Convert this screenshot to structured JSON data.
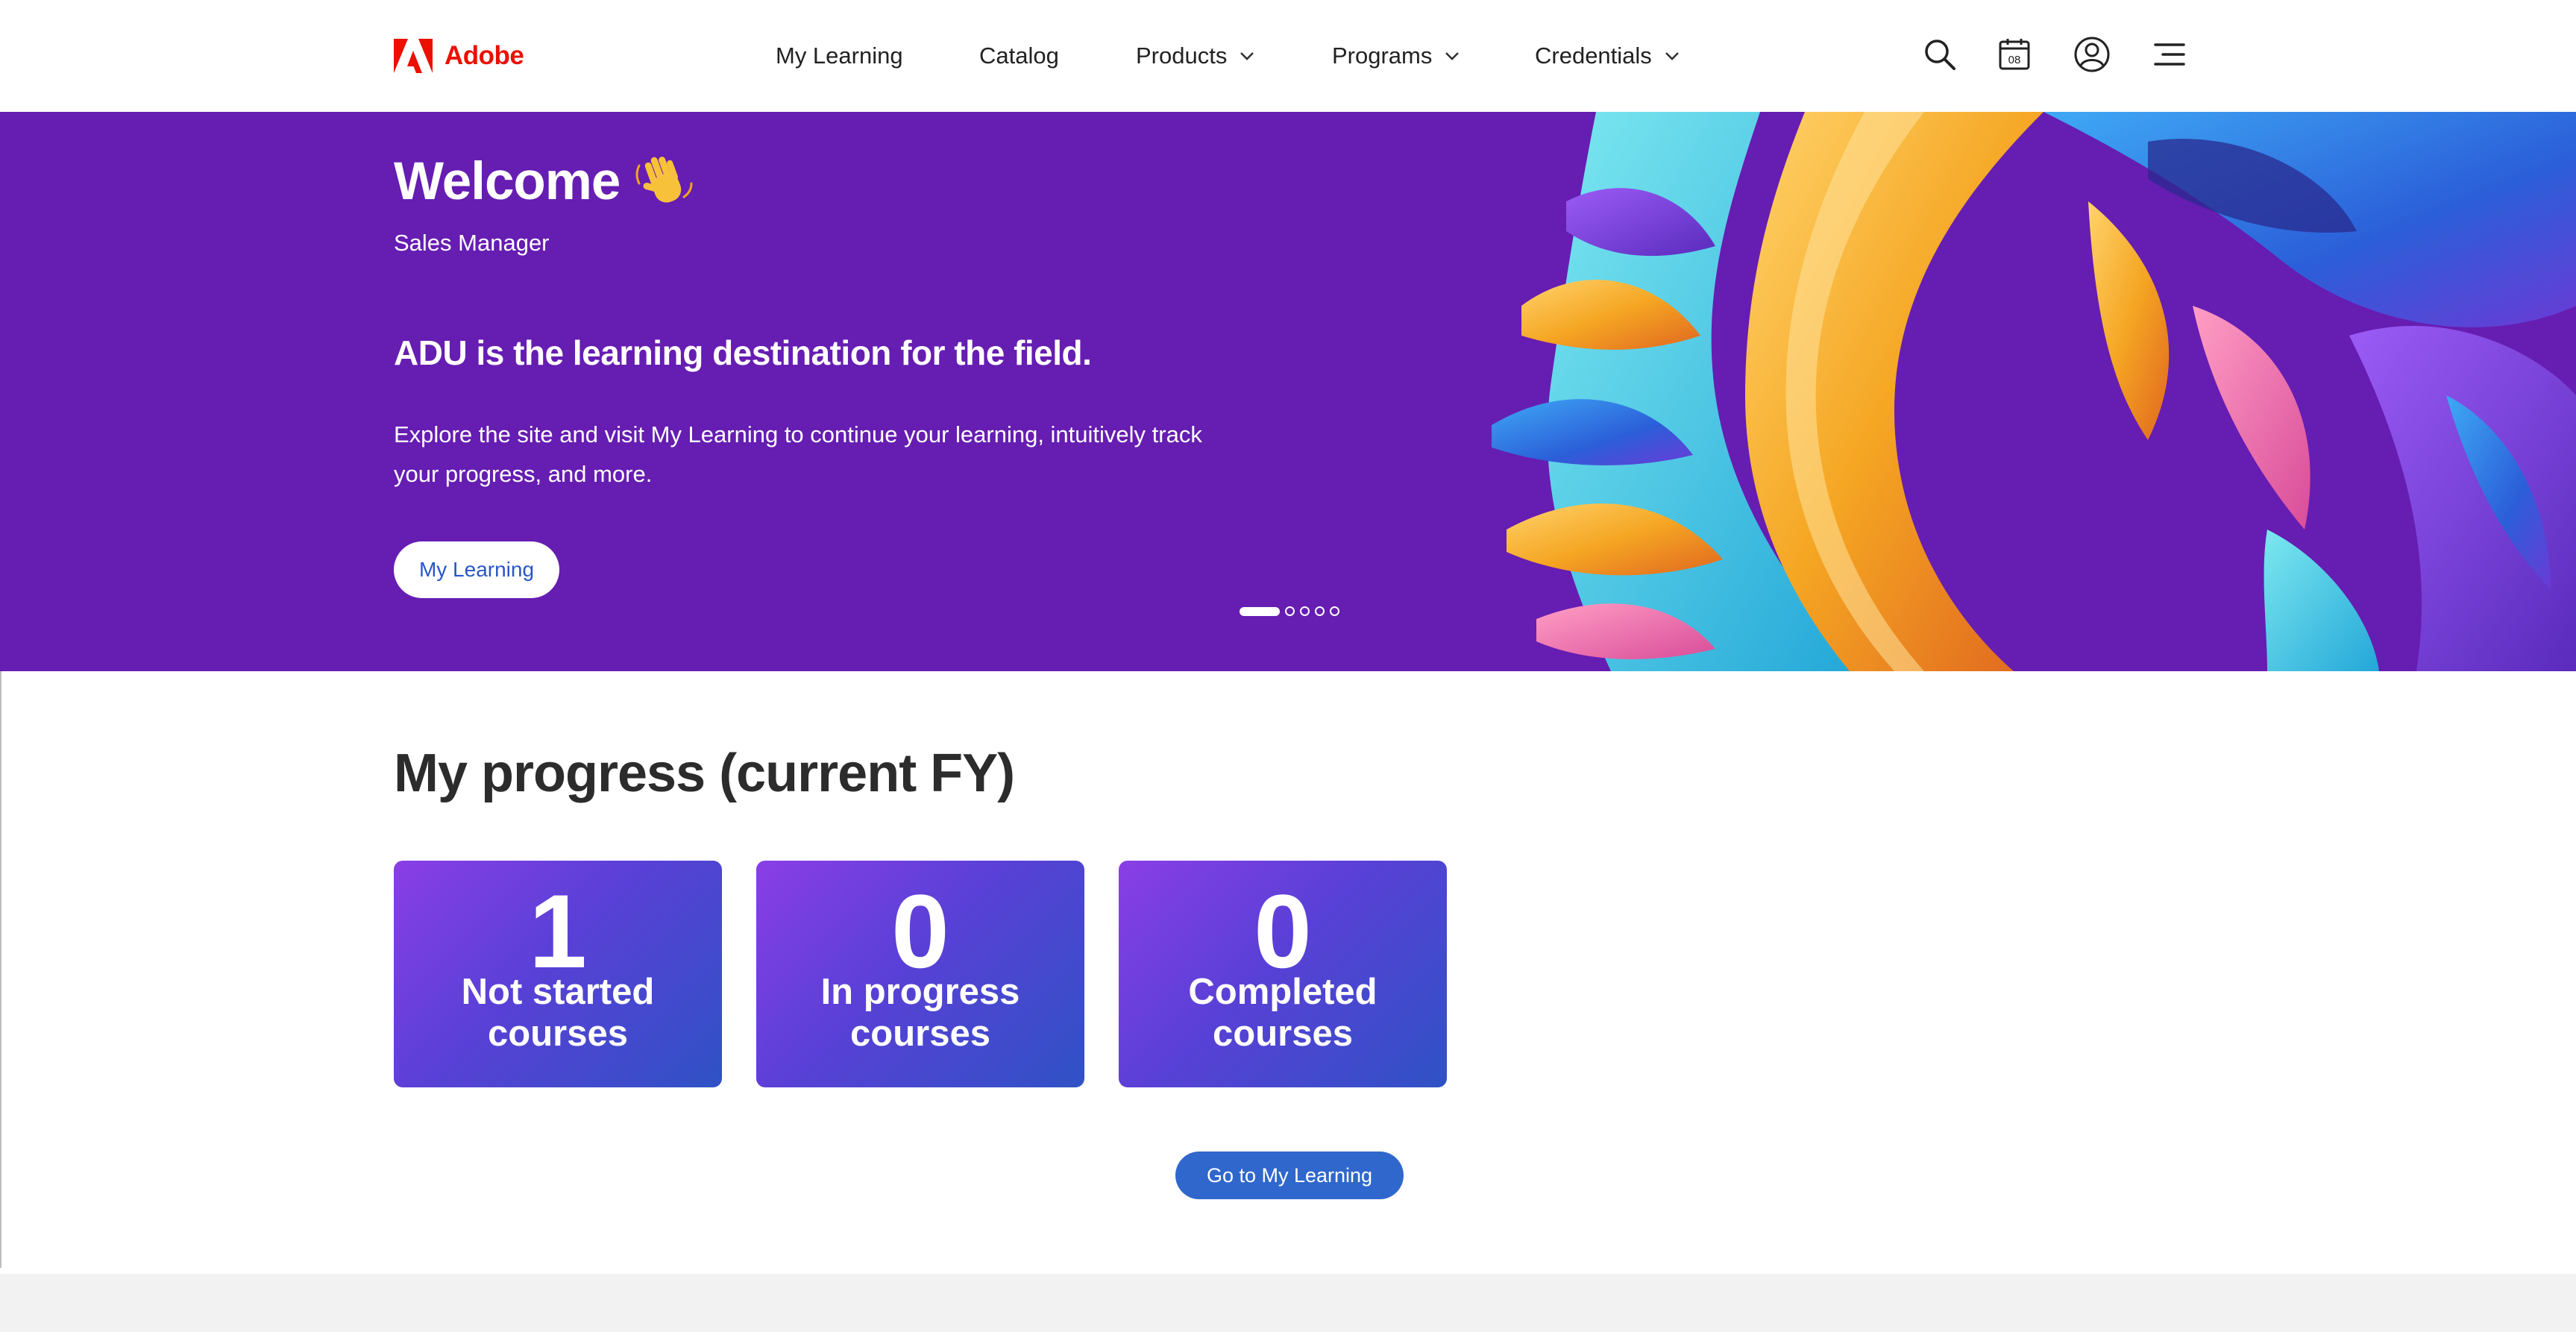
{
  "brand": {
    "name": "Adobe",
    "color": "#eb1000"
  },
  "nav": {
    "items": [
      {
        "label": "My Learning",
        "has_dropdown": false
      },
      {
        "label": "Catalog",
        "has_dropdown": false
      },
      {
        "label": "Products",
        "has_dropdown": true
      },
      {
        "label": "Programs",
        "has_dropdown": true
      },
      {
        "label": "Credentials",
        "has_dropdown": true
      }
    ],
    "icons": [
      "search-icon",
      "calendar-icon",
      "account-icon",
      "menu-icon"
    ],
    "calendar_day": "08"
  },
  "hero": {
    "welcome": "Welcome",
    "emoji": "waving-hand",
    "role": "Sales Manager",
    "headline": "ADU is the learning destination for the field.",
    "description": "Explore the site and visit My Learning to continue your learning, intuitively track your progress, and more.",
    "button_label": "My Learning",
    "background": "#661db2",
    "slides_total": 5,
    "active_slide": 1
  },
  "progress": {
    "title": "My progress (current FY)",
    "cards": [
      {
        "count": "1",
        "line1": "Not started",
        "line2": "courses"
      },
      {
        "count": "0",
        "line1": "In progress",
        "line2": "courses"
      },
      {
        "count": "0",
        "line1": "Completed",
        "line2": "courses"
      }
    ],
    "cta_label": "Go to My Learning"
  },
  "colors": {
    "accent_blue": "#3067cc",
    "card_gradient_start": "#8a3ee6",
    "card_gradient_end": "#2f52c5"
  }
}
